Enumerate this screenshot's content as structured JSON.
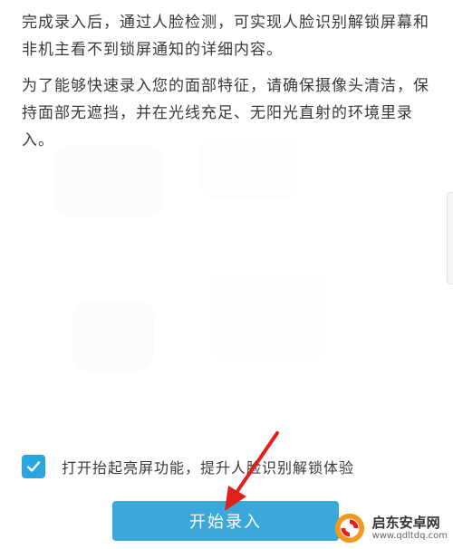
{
  "intro": {
    "paragraph1": "完成录入后，通过人脸检测，可实现人脸识别解锁屏幕和非机主看不到锁屏通知的详细内容。",
    "paragraph2": "为了能够快速录入您的面部特征，请确保摄像头清洁，保持面部无遮挡，并在光线充足、无阳光直射的环境里录入。"
  },
  "checkbox": {
    "label": "打开抬起亮屏功能，提升人脸识别解锁体验",
    "checked": true,
    "color": "#2ba5de"
  },
  "start_button": {
    "label": "开始录入",
    "color": "#3aa8d8"
  },
  "annotation": {
    "arrow_color": "#e0201c"
  },
  "watermark": {
    "title": "启东安卓网",
    "url": "www.qdltdq.com"
  }
}
